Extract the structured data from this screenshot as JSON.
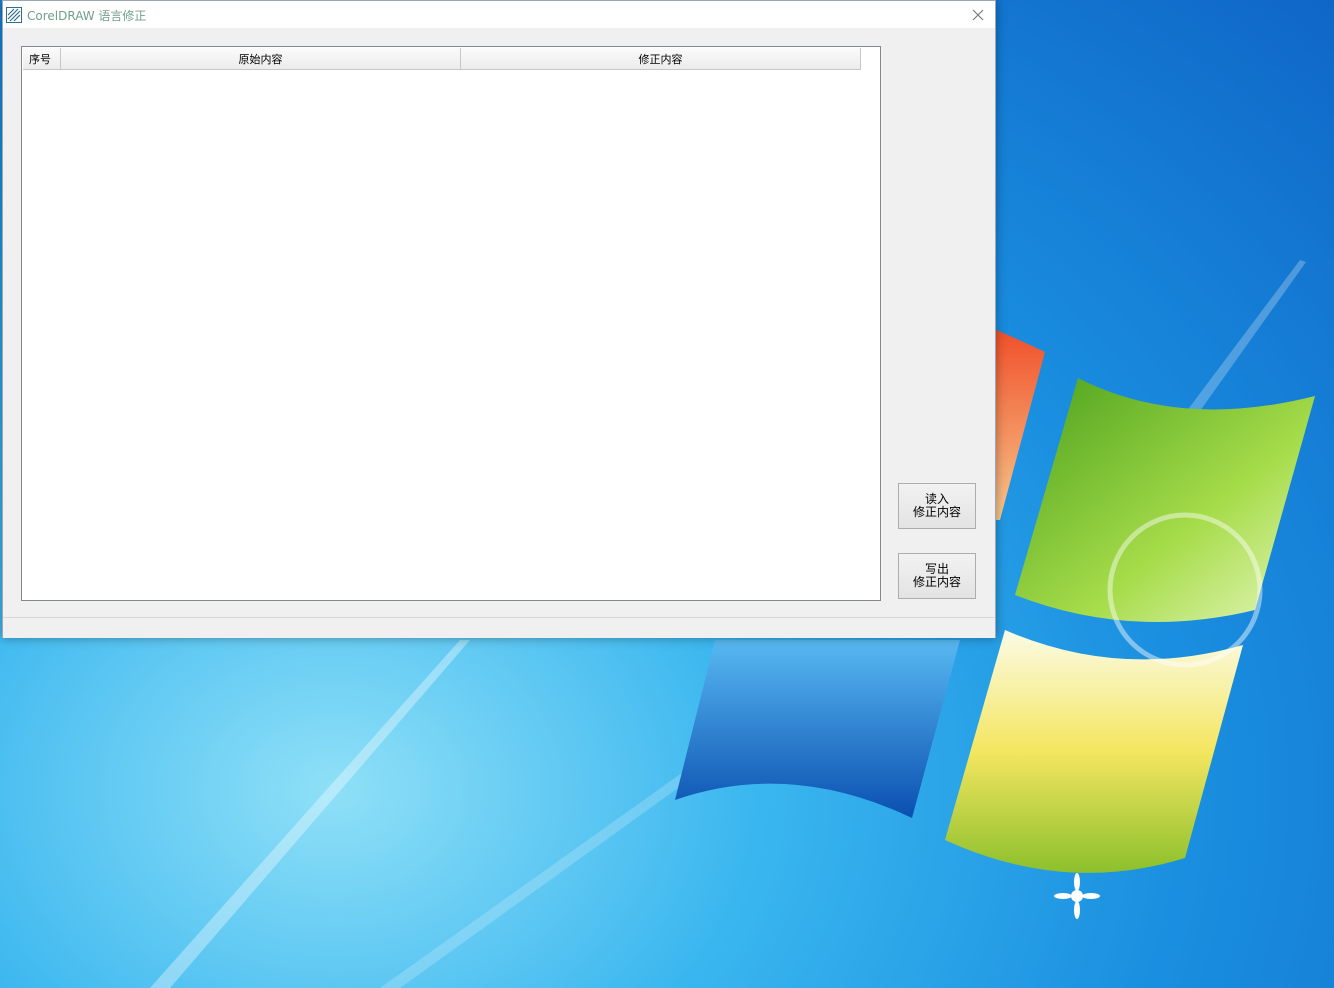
{
  "window": {
    "title": "CorelDRAW 语言修正",
    "icon": "coreldraw-app-icon",
    "close_icon": "close-icon"
  },
  "list": {
    "columns": [
      {
        "label": "序号"
      },
      {
        "label": "原始内容"
      },
      {
        "label": "修正内容"
      }
    ],
    "rows": []
  },
  "buttons": {
    "read": {
      "line1": "读入",
      "line2": "修正内容"
    },
    "write": {
      "line1": "写出",
      "line2": "修正内容"
    }
  },
  "desktop": {
    "wallpaper": "windows-7-logo-wallpaper",
    "colors": {
      "sky_light": "#8fe0f7",
      "sky_dark": "#0f66c7",
      "flag_red": "#f06a3a",
      "flag_green": "#6cbf2c",
      "flag_blue": "#1a7fd8",
      "flag_yellow": "#f2d22e"
    }
  }
}
